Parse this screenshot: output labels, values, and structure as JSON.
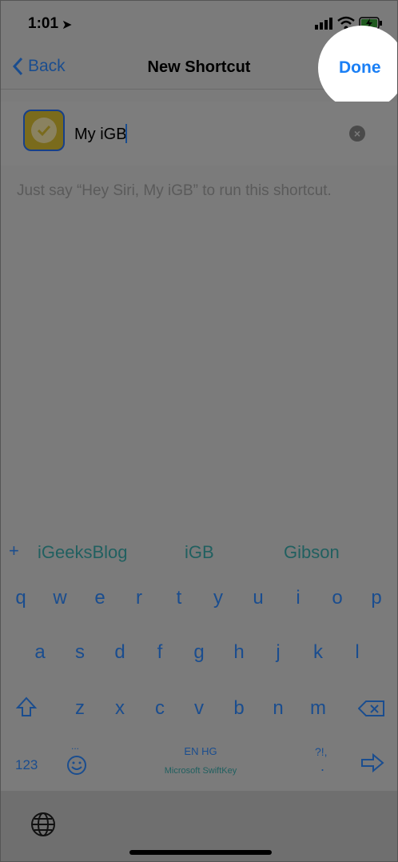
{
  "status": {
    "time": "1:01"
  },
  "nav": {
    "back_label": "Back",
    "title": "New Shortcut",
    "done_label": "Done"
  },
  "shortcut": {
    "name_value": "My iGB",
    "hint": "Just say “Hey Siri, My iGB” to run this shortcut."
  },
  "keyboard": {
    "suggestions": [
      "iGeeksBlog",
      "iGB",
      "Gibson"
    ],
    "row1": [
      "q",
      "w",
      "e",
      "r",
      "t",
      "y",
      "u",
      "i",
      "o",
      "p"
    ],
    "row2": [
      "a",
      "s",
      "d",
      "f",
      "g",
      "h",
      "j",
      "k",
      "l"
    ],
    "row3": [
      "z",
      "x",
      "c",
      "v",
      "b",
      "n",
      "m"
    ],
    "numbers_label": "123",
    "language_label": "EN HG",
    "brand_label": "Microsoft SwiftKey",
    "punct_label": "?!,",
    "punct_dot": ".",
    "emoji_dots": "..."
  },
  "colors": {
    "accent": "#1a7ff5",
    "dim_accent": "#1a4d8f",
    "overlay": "#7b7b7b"
  }
}
